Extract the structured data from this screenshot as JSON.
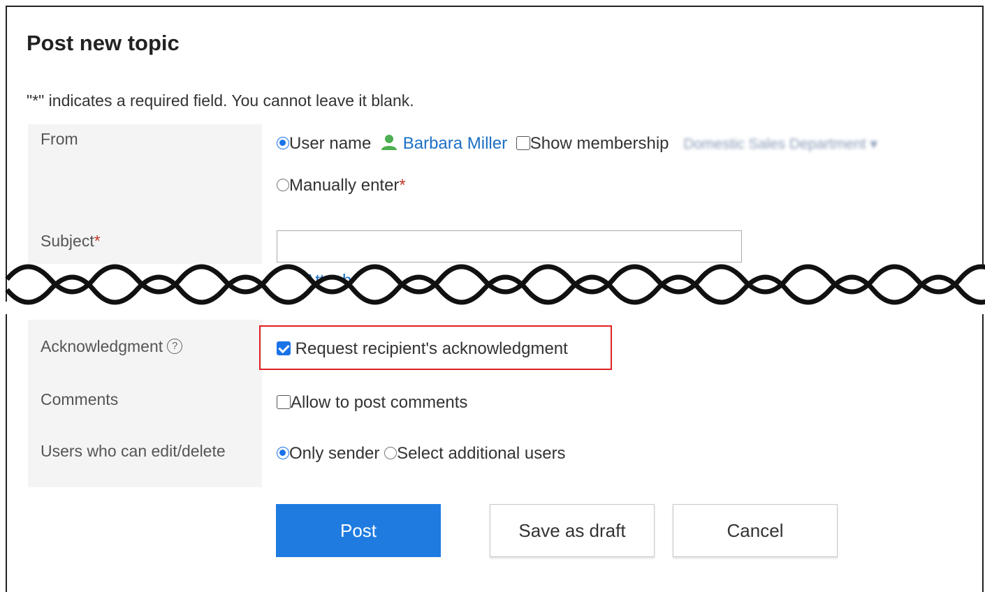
{
  "title": "Post new topic",
  "required_note": {
    "mark": "\"*\"",
    "text": " indicates a required field. You cannot leave it blank."
  },
  "from": {
    "label": "From",
    "user_name_option": "User name",
    "user_name": "Barbara Miller",
    "show_membership_label": "Show membership",
    "membership_value": "Domestic Sales Department",
    "manual_option": "Manually enter",
    "required_mark": "*"
  },
  "subject": {
    "label": "Subject",
    "required_mark": "*",
    "value": "",
    "attach_files_label": "Attach files"
  },
  "acknowledgment": {
    "label": "Acknowledgment",
    "help": "?",
    "checkbox_label": "Request recipient's acknowledgment",
    "checked": true
  },
  "comments": {
    "label": "Comments",
    "checkbox_label": "Allow to post comments",
    "checked": false
  },
  "editors": {
    "label": "Users who can edit/delete",
    "option_only_sender": "Only sender",
    "option_additional": "Select additional users",
    "selected": "Only sender"
  },
  "buttons": {
    "post": "Post",
    "save_draft": "Save as draft",
    "cancel": "Cancel"
  },
  "colors": {
    "accent": "#1f7be0",
    "highlight": "#e02020",
    "required": "#c0392b",
    "link": "#1c6fc4"
  }
}
